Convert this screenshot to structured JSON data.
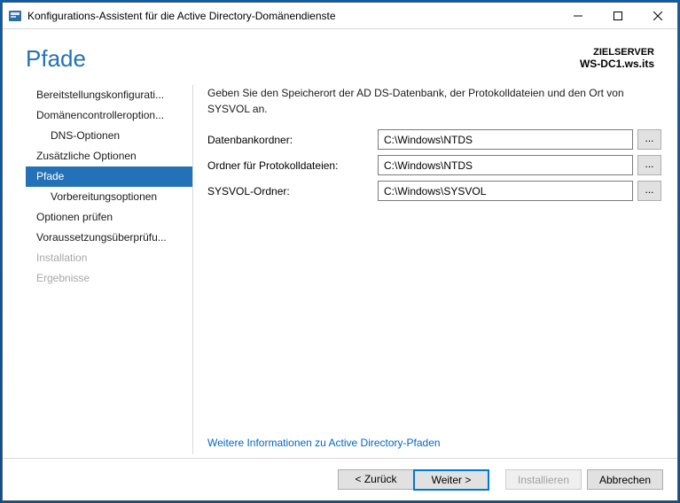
{
  "window": {
    "title": "Konfigurations-Assistent für die Active Directory-Domänendienste"
  },
  "header": {
    "title": "Pfade",
    "target_label": "ZIELSERVER",
    "server": "WS-DC1.ws.its"
  },
  "sidebar": {
    "items": [
      {
        "label": "Bereitstellungskonfigurati..."
      },
      {
        "label": "Domänencontrolleroption..."
      },
      {
        "label": "DNS-Optionen"
      },
      {
        "label": "Zusätzliche Optionen"
      },
      {
        "label": "Pfade"
      },
      {
        "label": "Vorbereitungsoptionen"
      },
      {
        "label": "Optionen prüfen"
      },
      {
        "label": "Voraussetzungsüberprüfu..."
      },
      {
        "label": "Installation"
      },
      {
        "label": "Ergebnisse"
      }
    ]
  },
  "main": {
    "description": "Geben Sie den Speicherort der AD DS-Datenbank, der Protokolldateien und den Ort von SYSVOL an.",
    "fields": {
      "db_label": "Datenbankordner:",
      "db_value": "C:\\Windows\\NTDS",
      "log_label": "Ordner für Protokolldateien:",
      "log_value": "C:\\Windows\\NTDS",
      "sysvol_label": "SYSVOL-Ordner:",
      "sysvol_value": "C:\\Windows\\SYSVOL"
    },
    "browse": "...",
    "more_link": "Weitere Informationen zu Active Directory-Pfaden"
  },
  "footer": {
    "back": "< Zurück",
    "next": "Weiter >",
    "install": "Installieren",
    "cancel": "Abbrechen"
  }
}
